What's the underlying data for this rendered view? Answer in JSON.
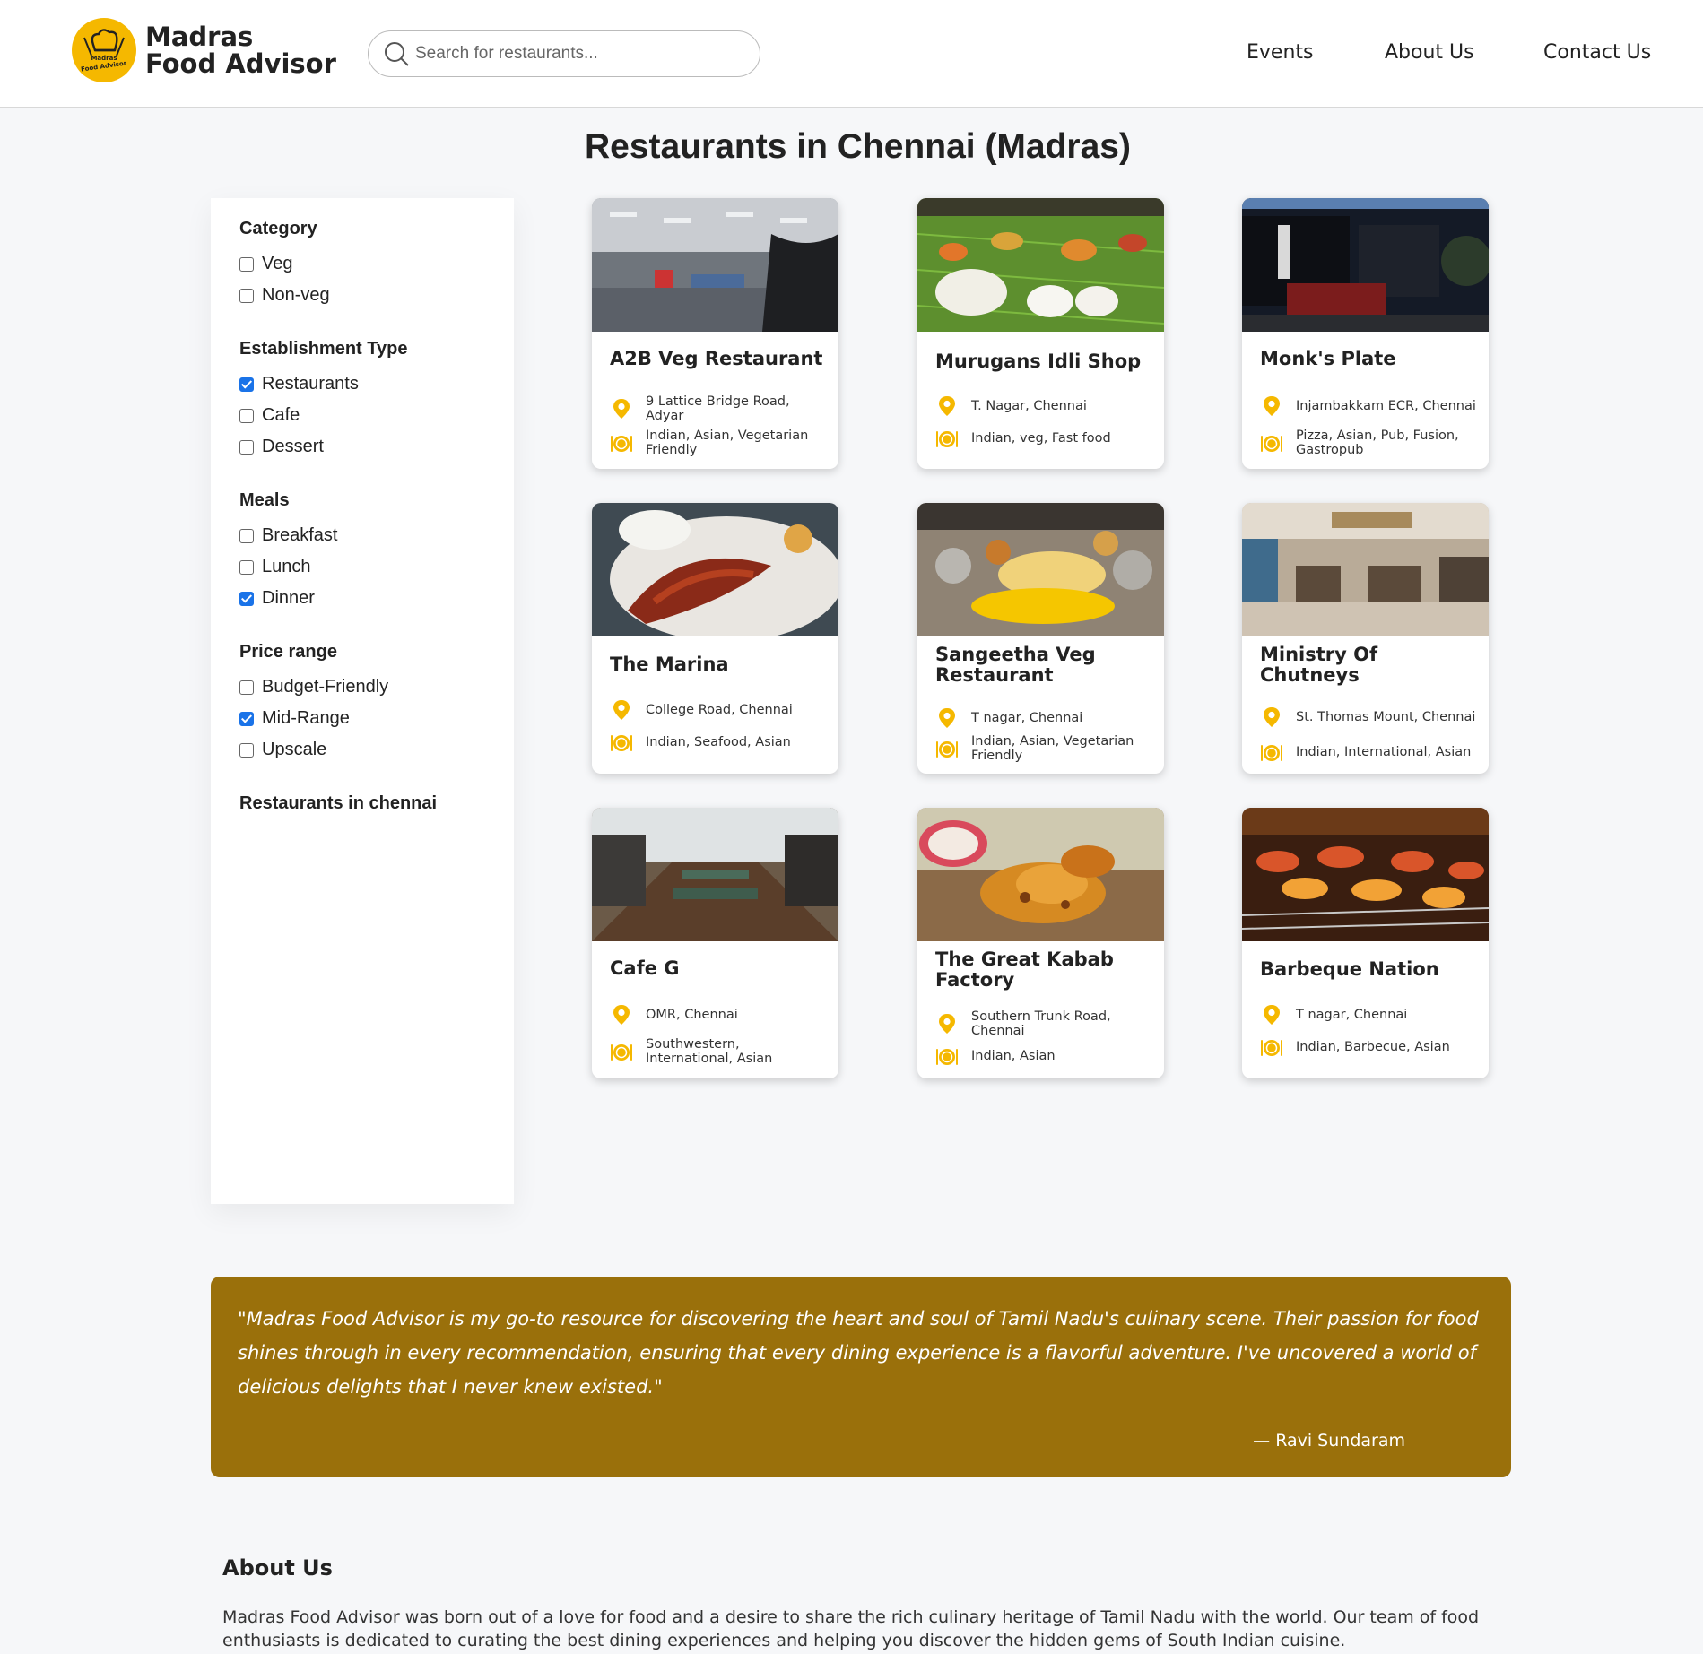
{
  "header": {
    "brand_line1": "Madras",
    "brand_line2": "Food Advisor",
    "logo_text_top": "Madras",
    "logo_text_bottom": "Food Advisor",
    "search_placeholder": "Search for restaurants...",
    "nav": [
      "Events",
      "About Us",
      "Contact Us"
    ]
  },
  "page_title": "Restaurants in Chennai (Madras)",
  "sidebar": {
    "groups": [
      {
        "title": "Category",
        "options": [
          {
            "label": "Veg",
            "checked": false
          },
          {
            "label": "Non-veg",
            "checked": false
          }
        ]
      },
      {
        "title": "Establishment Type",
        "options": [
          {
            "label": "Restaurants",
            "checked": true
          },
          {
            "label": "Cafe",
            "checked": false
          },
          {
            "label": "Dessert",
            "checked": false
          }
        ]
      },
      {
        "title": "Meals",
        "options": [
          {
            "label": "Breakfast",
            "checked": false
          },
          {
            "label": "Lunch",
            "checked": false
          },
          {
            "label": "Dinner",
            "checked": true
          }
        ]
      },
      {
        "title": "Price range",
        "options": [
          {
            "label": "Budget-Friendly",
            "checked": false
          },
          {
            "label": "Mid-Range",
            "checked": true
          },
          {
            "label": "Upscale",
            "checked": false
          }
        ]
      }
    ],
    "footer_title": "Restaurants in chennai"
  },
  "restaurants": [
    {
      "name": "A2B Veg Restaurant",
      "location": "9 Lattice Bridge Road, Adyar",
      "cuisine": "Indian, Asian, Vegetarian Friendly"
    },
    {
      "name": "Murugans Idli Shop",
      "location": "T. Nagar, Chennai",
      "cuisine": "Indian, veg, Fast food"
    },
    {
      "name": "Monk's Plate",
      "location": "Injambakkam ECR, Chennai",
      "cuisine": "Pizza, Asian, Pub, Fusion, Gastropub"
    },
    {
      "name": "The Marina",
      "location": "College Road, Chennai",
      "cuisine": "Indian, Seafood, Asian"
    },
    {
      "name": "Sangeetha Veg Restaurant",
      "location": "T nagar, Chennai",
      "cuisine": "Indian, Asian, Vegetarian Friendly"
    },
    {
      "name": "Ministry Of Chutneys",
      "location": "St. Thomas Mount, Chennai",
      "cuisine": "Indian, International, Asian"
    },
    {
      "name": "Cafe G",
      "location": "OMR, Chennai",
      "cuisine": "Southwestern, International, Asian"
    },
    {
      "name": "The Great Kabab Factory",
      "location": "Southern Trunk Road, Chennai",
      "cuisine": "Indian, Asian"
    },
    {
      "name": "Barbeque Nation",
      "location": "T nagar, Chennai",
      "cuisine": "Indian, Barbecue, Asian"
    }
  ],
  "testimonial": {
    "quote": "\"Madras Food Advisor is my go-to resource for discovering the heart and soul of Tamil Nadu's culinary scene. Their passion for food shines through in every recommendation, ensuring that every dining experience is a flavorful adventure. I've uncovered a world of delicious delights that I never knew existed.\"",
    "author": "— Ravi Sundaram"
  },
  "about": {
    "title": "About Us",
    "text": "Madras Food Advisor was born out of a love for food and a desire to share the rich culinary heritage of Tamil Nadu with the world. Our team of food enthusiasts is dedicated to curating the best dining experiences and helping you discover the hidden gems of South Indian cuisine."
  },
  "colors": {
    "accent": "#f5b800",
    "testimonial_bg": "#9a700b",
    "checkbox": "#1a73e8"
  }
}
